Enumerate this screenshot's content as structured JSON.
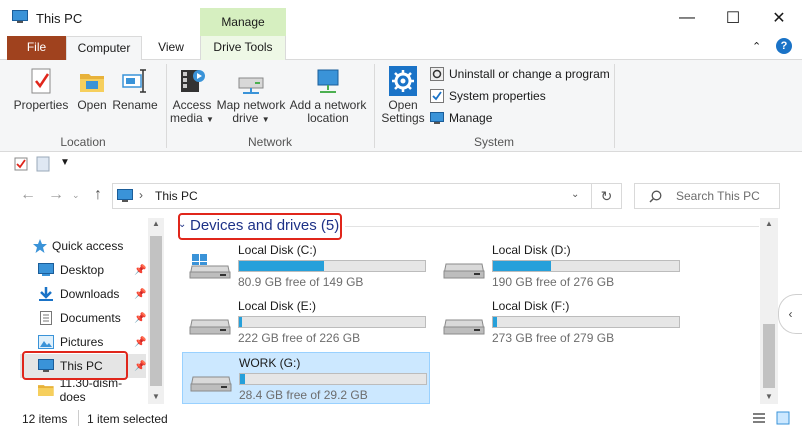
{
  "window": {
    "title": "This PC",
    "context_tab_group": "Manage",
    "controls": {
      "minimize": "—",
      "maximize": "☐",
      "close": "✕"
    }
  },
  "tabs": {
    "file": "File",
    "computer": "Computer",
    "view": "View",
    "drive_tools": "Drive Tools"
  },
  "ribbon": {
    "location": {
      "label": "Location",
      "properties": "Properties",
      "open": "Open",
      "rename": "Rename"
    },
    "network": {
      "label": "Network",
      "access_media": [
        "Access",
        "media"
      ],
      "map_network_drive": [
        "Map network",
        "drive"
      ],
      "add_network_location": [
        "Add a network",
        "location"
      ]
    },
    "system": {
      "label": "System",
      "open_settings": [
        "Open",
        "Settings"
      ],
      "uninstall": "Uninstall or change a program",
      "system_properties": "System properties",
      "manage": "Manage"
    }
  },
  "address": {
    "path": "This PC",
    "search_placeholder": "Search This PC"
  },
  "nav": {
    "quick_access": "Quick access",
    "items": [
      {
        "label": "Desktop",
        "icon": "desktop-icon"
      },
      {
        "label": "Downloads",
        "icon": "downloads-icon"
      },
      {
        "label": "Documents",
        "icon": "documents-icon"
      },
      {
        "label": "Pictures",
        "icon": "pictures-icon"
      },
      {
        "label": "This PC",
        "icon": "this-pc-icon"
      },
      {
        "label": "11.30-dism-does",
        "icon": "folder-icon"
      }
    ]
  },
  "content": {
    "group_header": "Devices and drives (5)",
    "drives": [
      {
        "name": "Local Disk (C:)",
        "free": "80.9 GB free of 149 GB",
        "used_fraction": 0.457
      },
      {
        "name": "Local Disk (D:)",
        "free": "190 GB free of 276 GB",
        "used_fraction": 0.312
      },
      {
        "name": "Local Disk (E:)",
        "free": "222 GB free of 226 GB",
        "used_fraction": 0.018
      },
      {
        "name": "Local Disk (F:)",
        "free": "273 GB free of 279 GB",
        "used_fraction": 0.022
      },
      {
        "name": "WORK (G:)",
        "free": "28.4 GB free of 29.2 GB",
        "used_fraction": 0.027
      }
    ]
  },
  "status": {
    "items": "12 items",
    "selected": "1 item selected"
  },
  "colors": {
    "file_tab": "#a0421e",
    "manage_context": "#d6efc0",
    "highlight": "#e0261b",
    "drive_bar": "#26a0da",
    "group_header": "#1e3287"
  }
}
